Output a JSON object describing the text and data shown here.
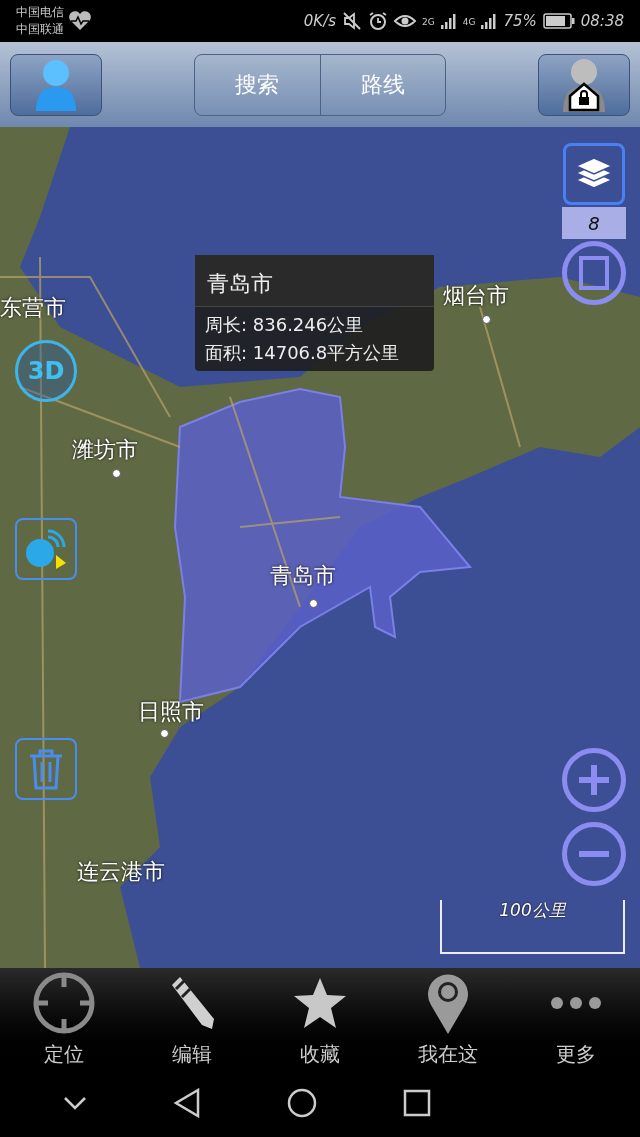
{
  "status_bar": {
    "carriers": [
      "中国电信",
      "中国联通"
    ],
    "speed": "0K/s",
    "network_1": "2G",
    "network_2": "4G",
    "battery": "75%",
    "time": "08:38"
  },
  "top_bar": {
    "segments": [
      {
        "label": "搜索",
        "selected": false
      },
      {
        "label": "路线",
        "selected": false
      }
    ]
  },
  "map": {
    "labels": [
      {
        "text": "东营市",
        "kind": "city"
      },
      {
        "text": "烟台市",
        "kind": "city"
      },
      {
        "text": "潍坊市",
        "kind": "city"
      },
      {
        "text": "青岛市",
        "kind": "city"
      },
      {
        "text": "日照市",
        "kind": "city"
      },
      {
        "text": "连云港市",
        "kind": "city"
      }
    ],
    "popup": {
      "title": "青岛市",
      "lines": [
        "周长: 836.246公里",
        "面积: 14706.8平方公里"
      ]
    },
    "layer_count": "8",
    "mode_button": "3D",
    "scale": "100公里"
  },
  "bottom_nav": [
    {
      "label": "定位",
      "kind": "crosshair"
    },
    {
      "label": "编辑",
      "kind": "pencil"
    },
    {
      "label": "收藏",
      "kind": "star"
    },
    {
      "label": "我在这",
      "kind": "pin"
    },
    {
      "label": "更多",
      "kind": "dots"
    }
  ]
}
